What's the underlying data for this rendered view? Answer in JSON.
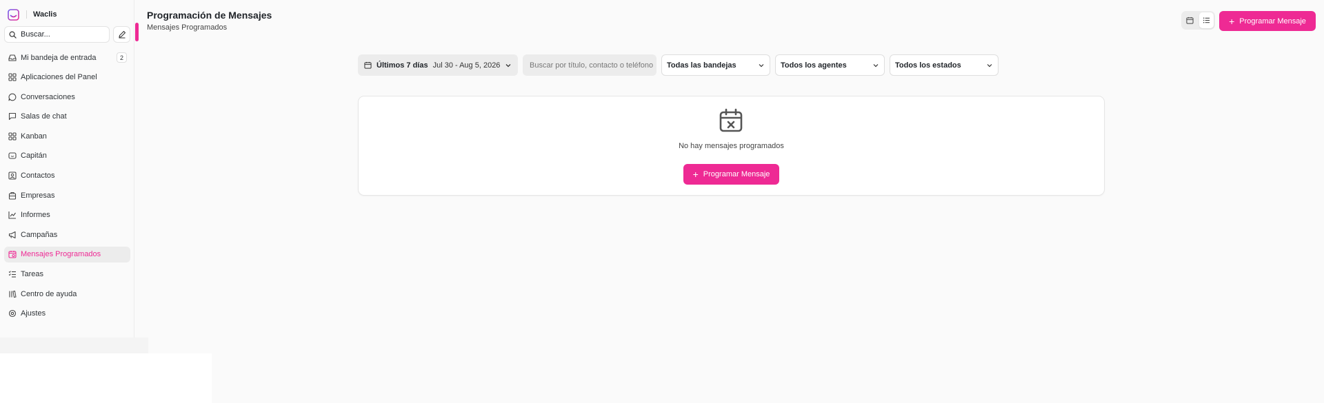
{
  "app": {
    "name": "Waclis"
  },
  "sidebar": {
    "search_label": "Buscar...",
    "items": [
      {
        "label": "Mi bandeja de entrada",
        "icon": "inbox-icon",
        "badge": "2"
      },
      {
        "label": "Aplicaciones del Panel",
        "icon": "apps-grid-icon"
      },
      {
        "label": "Conversaciones",
        "icon": "message-circle-icon"
      },
      {
        "label": "Salas de chat",
        "icon": "message-square-icon"
      },
      {
        "label": "Kanban",
        "icon": "kanban-grid-icon"
      },
      {
        "label": "Capitán",
        "icon": "bot-icon"
      },
      {
        "label": "Contactos",
        "icon": "contact-card-icon"
      },
      {
        "label": "Empresas",
        "icon": "building-icon"
      },
      {
        "label": "Informes",
        "icon": "chart-line-icon"
      },
      {
        "label": "Campañas",
        "icon": "megaphone-icon"
      },
      {
        "label": "Mensajes Programados",
        "icon": "calendar-clock-icon",
        "active": true
      },
      {
        "label": "Tareas",
        "icon": "list-checks-icon"
      },
      {
        "label": "Centro de ayuda",
        "icon": "library-icon"
      },
      {
        "label": "Ajustes",
        "icon": "settings-icon"
      }
    ]
  },
  "header": {
    "title": "Programación de Mensajes",
    "subtitle": "Mensajes Programados",
    "primary_button": "Programar Mensaje"
  },
  "filters": {
    "date_label": "Últimos 7 días",
    "date_range": "Jul 30 - Aug 5, 2026",
    "search_placeholder": "Buscar por título, contacto o teléfono",
    "inbox_select": "Todas las bandejas",
    "agent_select": "Todos los agentes",
    "status_select": "Todos los estados"
  },
  "empty_state": {
    "message": "No hay mensajes programados",
    "button": "Programar Mensaje"
  },
  "colors": {
    "accent": "#ee2a94",
    "sidebar_bg": "#fafafa",
    "main_bg": "#fafafa"
  }
}
